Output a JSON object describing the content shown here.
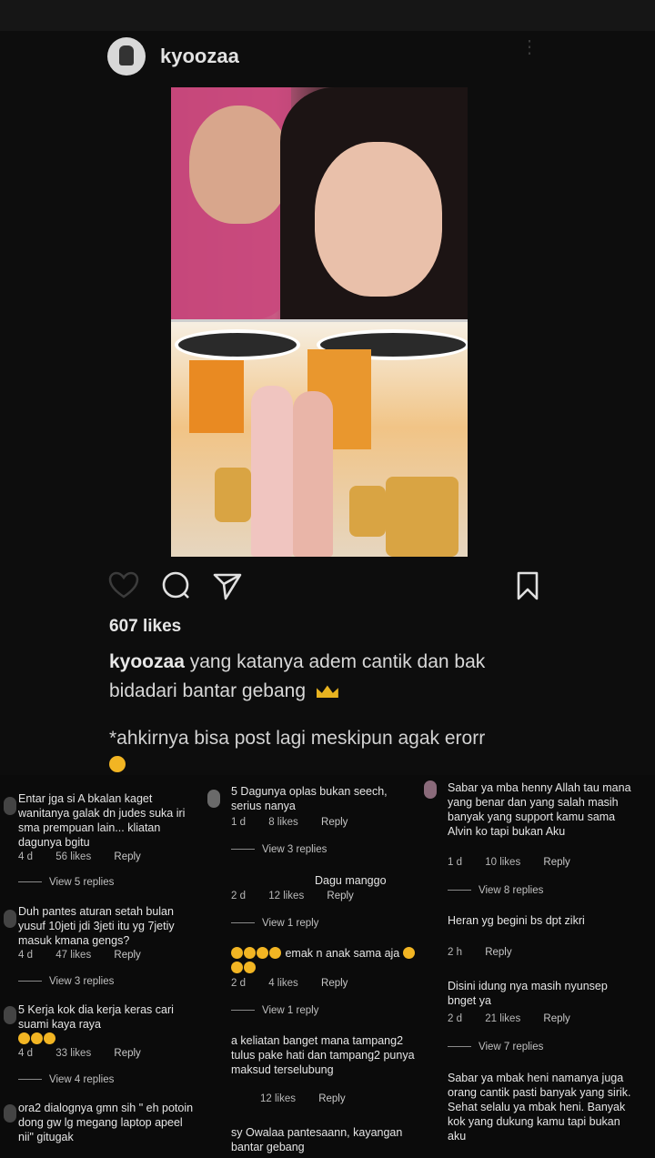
{
  "post": {
    "username": "kyoozaa",
    "likes": "607 likes",
    "caption_user": "kyoozaa",
    "caption_text": "yang katanya adem cantik dan bak bidadari bantar gebang",
    "caption_note": "*ahkirnya bisa post lagi meskipun agak erorr"
  },
  "comments": {
    "c1": [
      {
        "text": "Entar jga si A bkalan kaget wanitanya galak dn judes suka iri sma prempuan lain... kliatan dagunya bgitu",
        "age": "4 d",
        "likes": "56 likes",
        "reply": "Reply",
        "view": "View 5 replies"
      },
      {
        "text": "Duh pantes aturan setah bulan yusuf 10jeti jdi 3jeti itu yg 7jetiy masuk kmana gengs?",
        "age": "4 d",
        "likes": "47 likes",
        "reply": "Reply",
        "view": "View 3 replies"
      },
      {
        "text": "5 Kerja kok dia kerja keras cari suami kaya raya",
        "age": "4 d",
        "likes": "33 likes",
        "reply": "Reply",
        "view": "View 4 replies"
      },
      {
        "text": "ora2 dialognya gmn sih \" eh potoin dong gw lg megang laptop apeel nii\" gitugak"
      }
    ],
    "c2": [
      {
        "text": "5 Dagunya oplas bukan seech, serius nanya",
        "age": "1 d",
        "likes": "8 likes",
        "reply": "Reply",
        "view": "View 3 replies"
      },
      {
        "text": "Dagu manggo",
        "age": "2 d",
        "likes": "12 likes",
        "reply": "Reply",
        "view": "View 1 reply"
      },
      {
        "text": "emak n anak sama aja",
        "age": "2 d",
        "likes": "4 likes",
        "reply": "Reply",
        "view": "View 1 reply"
      },
      {
        "text": "a keliatan banget mana tampang2 tulus pake hati dan tampang2 punya maksud terselubung",
        "likes": "12 likes",
        "reply": "Reply"
      },
      {
        "text": "sy Owalaa pantesaann, kayangan bantar gebang"
      }
    ],
    "c3": [
      {
        "text": "Sabar ya mba henny Allah tau mana yang benar dan yang salah masih banyak yang support kamu sama Alvin ko tapi bukan Aku",
        "age": "1 d",
        "likes": "10 likes",
        "reply": "Reply",
        "view": "View 8 replies"
      },
      {
        "text": "Heran yg begini bs dpt zikri",
        "age": "2 h",
        "reply": "Reply"
      },
      {
        "text": "Disini idung nya masih nyunsep bnget ya",
        "age": "2 d",
        "likes": "21 likes",
        "reply": "Reply",
        "view": "View 7 replies"
      },
      {
        "text": "Sabar ya mbak heni namanya juga orang cantik pasti banyak yang sirik. Sehat selalu ya mbak heni. Banyak kok yang dukung kamu tapi bukan aku"
      }
    ]
  },
  "icons": [
    "heart-icon",
    "comment-icon",
    "share-icon",
    "bookmark-icon"
  ],
  "colors": {
    "background": "#000000",
    "text": "#e6e6e6",
    "emoji": "#f2b523"
  }
}
